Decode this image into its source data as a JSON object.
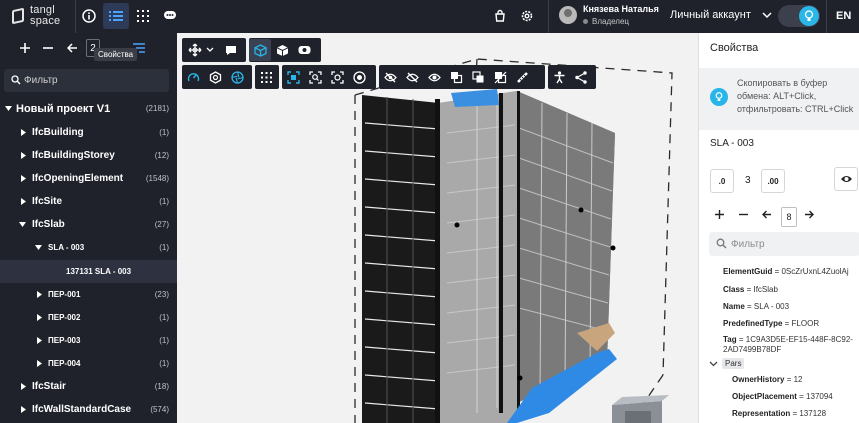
{
  "app": {
    "logo_line1": "tangl",
    "logo_line2": "space"
  },
  "user": {
    "name": "Князева Наталья",
    "role": "Владелец",
    "account": "Личный аккаунт"
  },
  "lang": "EN",
  "left_panel": {
    "level_value": "2",
    "tooltip": "Свойства",
    "filter_placeholder": "Фильтр",
    "tree": [
      {
        "label": "Новый проект V1",
        "count": "(2181)"
      },
      {
        "label": "IfcBuilding",
        "count": "(1)"
      },
      {
        "label": "IfcBuildingStorey",
        "count": "(12)"
      },
      {
        "label": "IfcOpeningElement",
        "count": "(1548)"
      },
      {
        "label": "IfcSite",
        "count": "(1)"
      },
      {
        "label": "IfcSlab",
        "count": "(27)"
      },
      {
        "label": "SLA - 003",
        "count": "(1)"
      },
      {
        "label": "137131  SLA - 003",
        "count": ""
      },
      {
        "label": "ПЕР-001",
        "count": "(23)"
      },
      {
        "label": "ПЕР-002",
        "count": "(1)"
      },
      {
        "label": "ПЕР-003",
        "count": "(1)"
      },
      {
        "label": "ПЕР-004",
        "count": "(1)"
      },
      {
        "label": "IfcStair",
        "count": "(18)"
      },
      {
        "label": "IfcWallStandardCase",
        "count": "(574)"
      }
    ]
  },
  "right_panel": {
    "title": "Свойства",
    "hint": "Скопировать в буфер обмена: ALT+Click, отфильтровать: CTRL+Click",
    "element_name": "SLA - 003",
    "decimal_dec_label": ".0",
    "decimal_inc_label": ".00",
    "decimals_value": "3",
    "level_value": "8",
    "filter_placeholder": "Фильтр",
    "properties": [
      {
        "key": "ElementGuid",
        "value": "0ScZrUxnL4ZuolAj"
      },
      {
        "key": "Class",
        "value": "IfcSlab"
      },
      {
        "key": "Name",
        "value": "SLA - 003"
      },
      {
        "key": "PredefinedType",
        "value": "FLOOR"
      },
      {
        "key": "Tag",
        "value": "1C9A3D5E-EF15-448F-8C92-2AD7499B78DF"
      }
    ],
    "group_name": "Pars",
    "group_properties": [
      {
        "key": "OwnerHistory",
        "value": "12"
      },
      {
        "key": "ObjectPlacement",
        "value": "137094"
      },
      {
        "key": "Representation",
        "value": "137128"
      }
    ]
  },
  "colors": {
    "dark": "#1f222b",
    "accent": "#29b5e8",
    "selection_blue": "#2a8fe0"
  }
}
